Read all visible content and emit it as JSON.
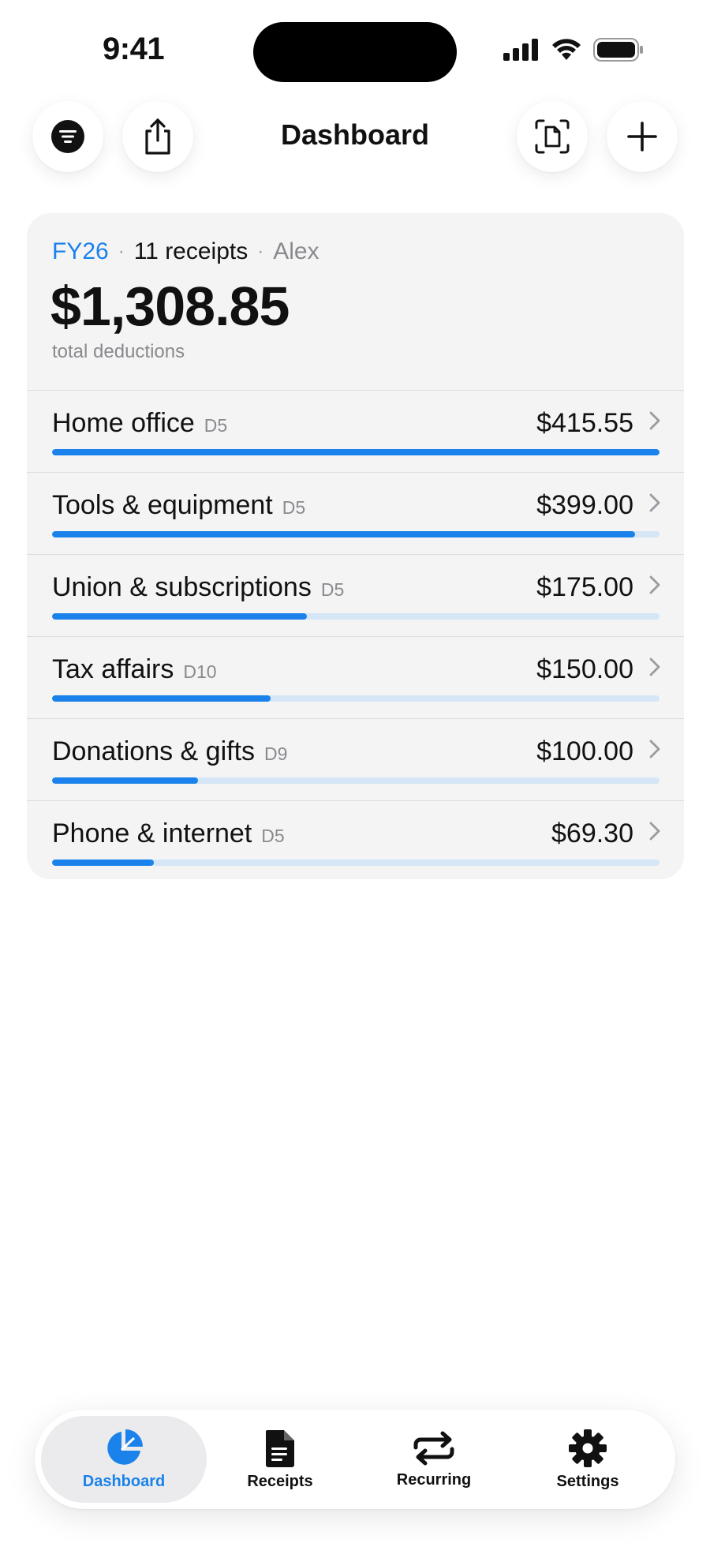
{
  "status": {
    "time": "9:41"
  },
  "header": {
    "title": "Dashboard"
  },
  "summary": {
    "fy": "FY26",
    "receipts": "11 receipts",
    "user": "Alex",
    "total": "$1,308.85",
    "total_label": "total deductions"
  },
  "categories": [
    {
      "label": "Home office",
      "code": "D5",
      "amount": "$415.55",
      "share": 1.0
    },
    {
      "label": "Tools & equipment",
      "code": "D5",
      "amount": "$399.00",
      "share": 0.96
    },
    {
      "label": "Union & subscriptions",
      "code": "D5",
      "amount": "$175.00",
      "share": 0.42
    },
    {
      "label": "Tax affairs",
      "code": "D10",
      "amount": "$150.00",
      "share": 0.36
    },
    {
      "label": "Donations & gifts",
      "code": "D9",
      "amount": "$100.00",
      "share": 0.24
    },
    {
      "label": "Phone & internet",
      "code": "D5",
      "amount": "$69.30",
      "share": 0.167
    }
  ],
  "tabs": [
    {
      "label": "Dashboard",
      "icon": "pie-chart-icon",
      "active": true
    },
    {
      "label": "Receipts",
      "icon": "document-icon",
      "active": false
    },
    {
      "label": "Recurring",
      "icon": "repeat-icon",
      "active": false
    },
    {
      "label": "Settings",
      "icon": "gear-icon",
      "active": false
    }
  ],
  "colors": {
    "accent": "#1a82ea",
    "track": "#d5e6f7",
    "card": "#f4f4f5"
  }
}
